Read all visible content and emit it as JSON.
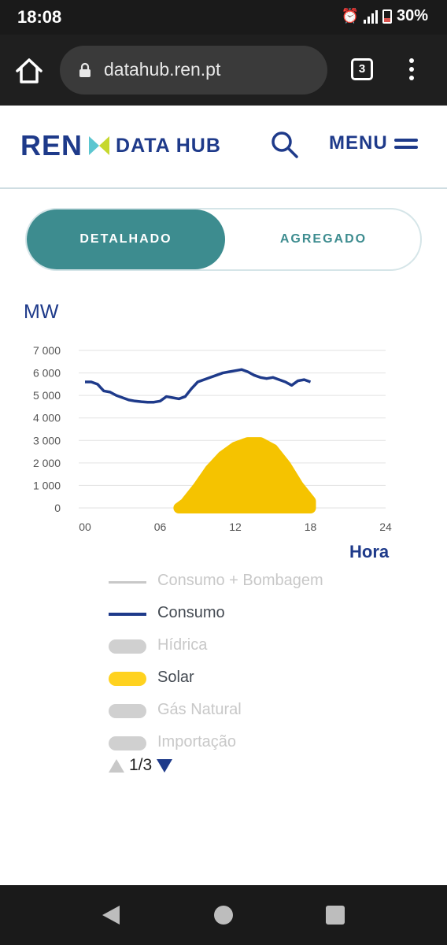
{
  "status_bar": {
    "time": "18:08",
    "battery": "30%"
  },
  "browser": {
    "url": "datahub.ren.pt",
    "tab_count": "3"
  },
  "header": {
    "logo_ren": "REN",
    "logo_hub": "DATA HUB",
    "menu_label": "MENU"
  },
  "toggle": {
    "active": "DETALHADO",
    "inactive": "AGREGADO"
  },
  "colors": {
    "brand_navy": "#1e3a8a",
    "teal": "#3d8c8f",
    "solar": "#f5c300",
    "muted": "#c8c8c8"
  },
  "chart_data": {
    "type": "line",
    "ylabel": "MW",
    "xlabel": "Hora",
    "x_ticks": [
      "00",
      "06",
      "12",
      "18",
      "24"
    ],
    "y_ticks": [
      "0",
      "1 000",
      "2 000",
      "3 000",
      "4 000",
      "5 000",
      "6 000",
      "7 000"
    ],
    "xlim": [
      0,
      24
    ],
    "ylim": [
      0,
      7000
    ],
    "grid": true,
    "series": [
      {
        "name": "Consumo",
        "color": "#1e3a8a",
        "x": [
          0,
          0.5,
          1,
          1.5,
          2,
          2.5,
          3,
          3.5,
          4,
          4.5,
          5,
          5.5,
          6,
          6.5,
          7,
          7.5,
          8,
          8.5,
          9,
          9.5,
          10,
          10.5,
          11,
          11.5,
          12,
          12.5,
          13,
          13.5,
          14,
          14.5,
          15,
          15.5,
          16,
          16.5,
          17,
          17.5,
          18
        ],
        "values": [
          5600,
          5600,
          5500,
          5200,
          5150,
          5000,
          4900,
          4800,
          4750,
          4720,
          4700,
          4700,
          4750,
          4950,
          4900,
          4850,
          4950,
          5300,
          5600,
          5700,
          5800,
          5900,
          6000,
          6050,
          6100,
          6150,
          6050,
          5900,
          5800,
          5750,
          5800,
          5700,
          5600,
          5450,
          5650,
          5700,
          5600
        ]
      },
      {
        "name": "Solar",
        "color": "#f5c300",
        "x": [
          7.5,
          8,
          9,
          10,
          11,
          12,
          13,
          14,
          15,
          16,
          17,
          18
        ],
        "values": [
          0,
          200,
          900,
          1700,
          2300,
          2700,
          2900,
          2900,
          2600,
          1900,
          1000,
          300
        ]
      }
    ]
  },
  "legend": {
    "items": [
      {
        "label": "Consumo + Bombagem",
        "state": "off"
      },
      {
        "label": "Consumo",
        "state": "on"
      },
      {
        "label": "Hídrica",
        "state": "off"
      },
      {
        "label": "Solar",
        "state": "on"
      },
      {
        "label": "Gás Natural",
        "state": "off"
      },
      {
        "label": "Importação",
        "state": "off"
      }
    ],
    "page": "1/3"
  }
}
